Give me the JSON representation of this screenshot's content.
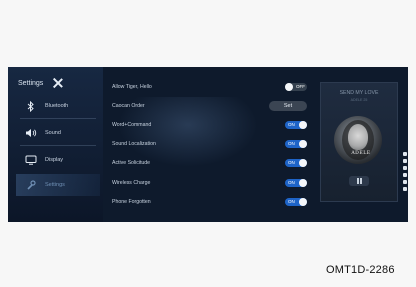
{
  "sidebar": {
    "title": "Settings",
    "items": [
      {
        "label": "Bluetooth",
        "icon": "bluetooth-icon"
      },
      {
        "label": "Sound",
        "icon": "speaker-icon"
      },
      {
        "label": "Display",
        "icon": "monitor-icon"
      },
      {
        "label": "Settings",
        "icon": "wrench-icon"
      }
    ]
  },
  "settings": [
    {
      "label": "Allow Tiger, Hello",
      "control": "toggle",
      "state": "OFF"
    },
    {
      "label": "Caocan Order",
      "control": "button",
      "state": "Set"
    },
    {
      "label": "Word+Command",
      "control": "toggle",
      "state": "ON"
    },
    {
      "label": "Sound Localization",
      "control": "toggle",
      "state": "ON"
    },
    {
      "label": "Active Solicitude",
      "control": "toggle",
      "state": "ON"
    },
    {
      "label": "Wireless Charge",
      "control": "toggle",
      "state": "ON"
    },
    {
      "label": "Phone Forgotten",
      "control": "toggle",
      "state": "ON"
    }
  ],
  "player": {
    "song_title": "SEND MY LOVE",
    "artist_small": "ADELE 25",
    "album_text": "ADELE"
  },
  "figure_code": "OMT1D-2286",
  "colors": {
    "screen_bg": "#0e1a2c",
    "toggle_on": "#1e64c8",
    "toggle_off": "#34404e"
  }
}
